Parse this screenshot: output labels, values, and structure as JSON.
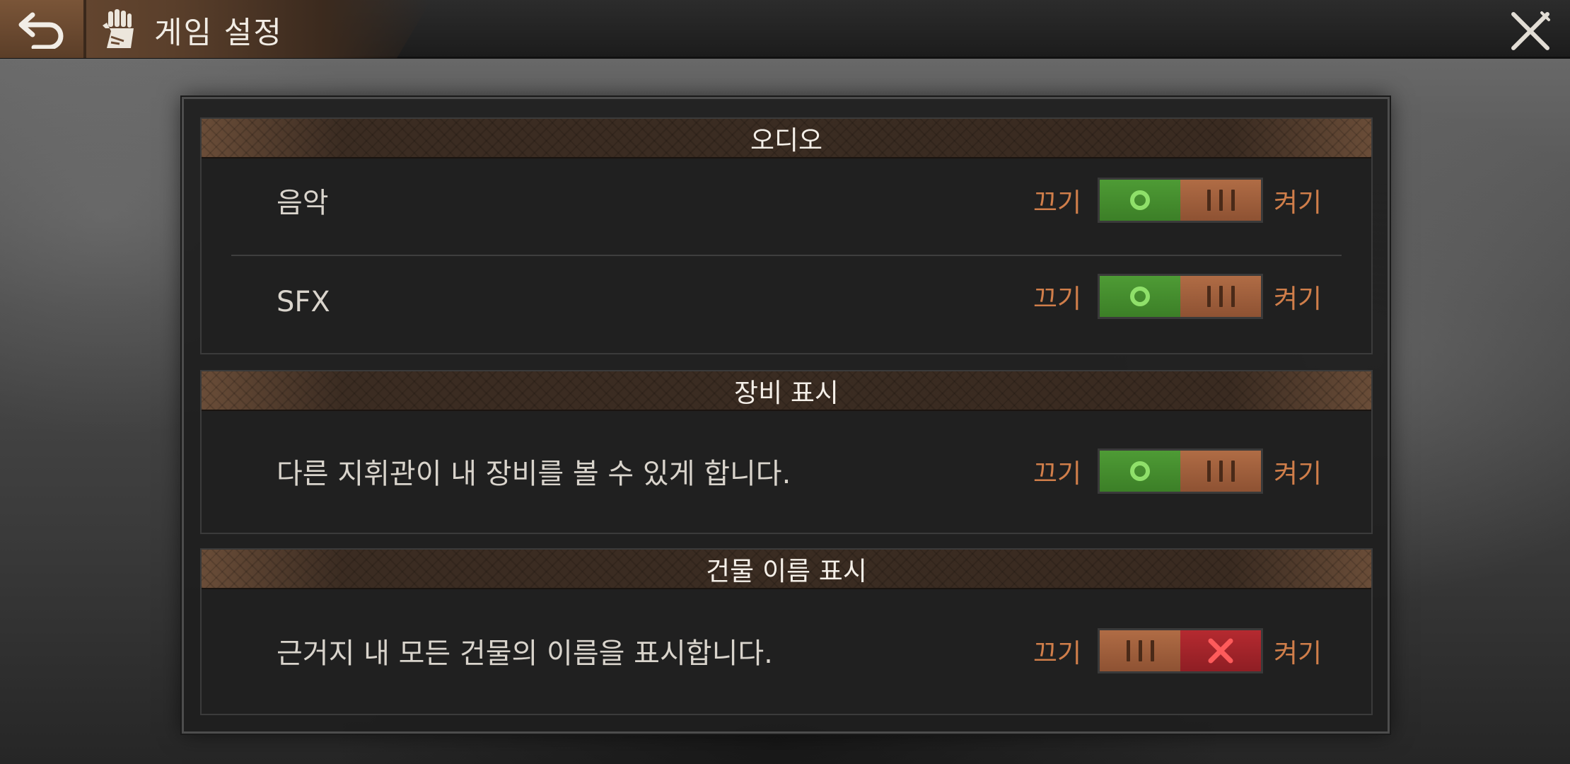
{
  "header": {
    "title": "게임 설정",
    "back_icon": "back-arrow-icon",
    "page_icon": "settings-fist-icon",
    "close_icon": "close-x-icon"
  },
  "sections": [
    {
      "title": "오디오",
      "rows": [
        {
          "label": "음악",
          "off_label": "끄기",
          "on_label": "켜기",
          "state": "on"
        },
        {
          "label": "SFX",
          "off_label": "끄기",
          "on_label": "켜기",
          "state": "on"
        }
      ]
    },
    {
      "title": "장비 표시",
      "rows": [
        {
          "label": "다른 지휘관이 내 장비를 볼 수 있게 합니다.",
          "off_label": "끄기",
          "on_label": "켜기",
          "state": "on"
        }
      ]
    },
    {
      "title": "건물 이름 표시",
      "rows": [
        {
          "label": "근거지 내 모든 건물의 이름을 표시합니다.",
          "off_label": "끄기",
          "on_label": "켜기",
          "state": "off"
        }
      ]
    }
  ],
  "colors": {
    "accent_orange": "#d07e4a",
    "toggle_on_green": "#4e9b35",
    "toggle_off_red": "#b52a30",
    "header_brown": "#6a4d38"
  }
}
